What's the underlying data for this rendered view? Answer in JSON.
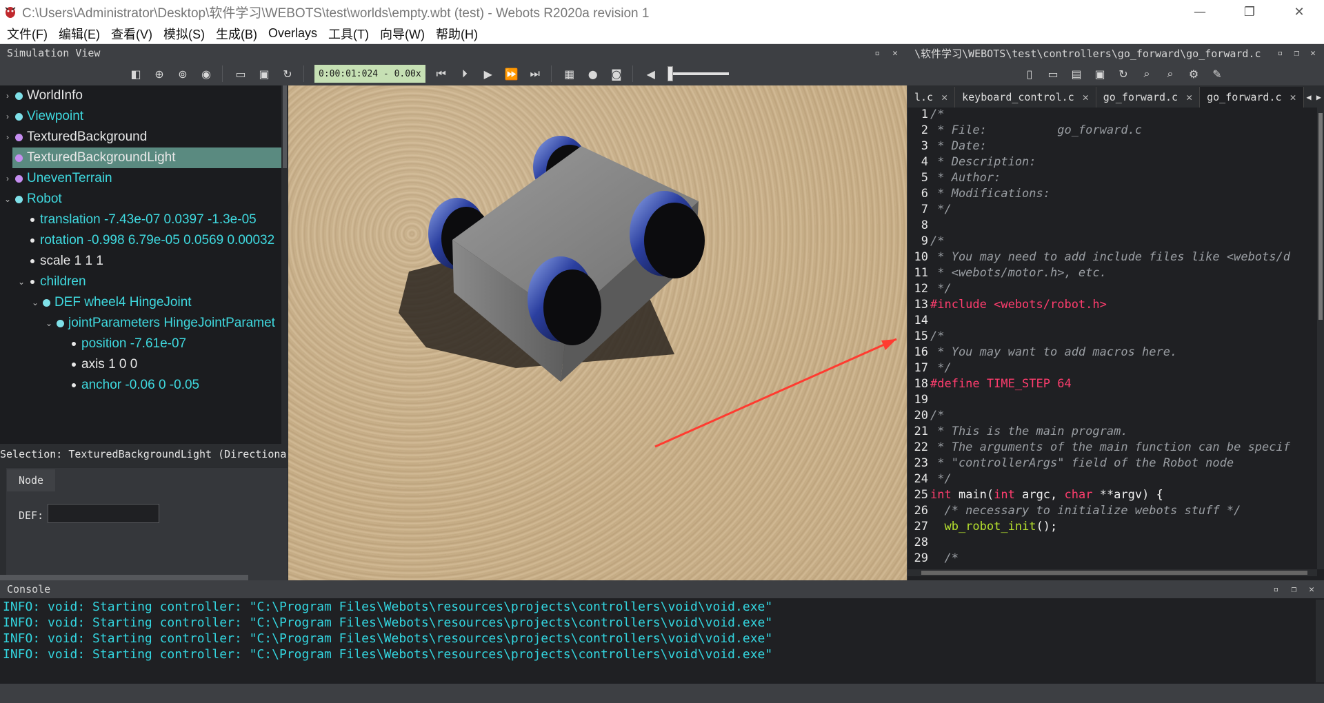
{
  "window": {
    "title": "C:\\Users\\Administrator\\Desktop\\软件学习\\WEBOTS\\test\\worlds\\empty.wbt (test) - Webots R2020a revision 1",
    "minimize": "—",
    "restore": "❐",
    "close": "✕"
  },
  "menu": [
    "文件(F)",
    "编辑(E)",
    "查看(V)",
    "模拟(S)",
    "生成(B)",
    "Overlays",
    "工具(T)",
    "向导(W)",
    "帮助(H)"
  ],
  "sim_panel": {
    "title": "Simulation View",
    "time": "0:00:01:024 - 0.00x"
  },
  "scene_tree": [
    {
      "label": "WorldInfo",
      "color": "#e8e8e8",
      "dot": "#7fe0e8",
      "indent": 0,
      "arrow": "›"
    },
    {
      "label": "Viewpoint",
      "color": "#3fd9df",
      "dot": "#7fe0e8",
      "indent": 0,
      "arrow": "›"
    },
    {
      "label": "TexturedBackground",
      "color": "#e8e8e8",
      "dot": "#c58ef0",
      "indent": 0,
      "arrow": "›"
    },
    {
      "label": "TexturedBackgroundLight",
      "color": "#e8e8e8",
      "dot": "#c58ef0",
      "indent": 0,
      "arrow": "›",
      "selected": true
    },
    {
      "label": "UnevenTerrain",
      "color": "#3fd9df",
      "dot": "#c58ef0",
      "indent": 0,
      "arrow": "›"
    },
    {
      "label": "Robot",
      "color": "#3fd9df",
      "dot": "#7fe0e8",
      "indent": 0,
      "arrow": "⌄"
    },
    {
      "label": "translation -7.43e-07 0.0397 -1.3e-05",
      "color": "#3fd9df",
      "indent": 1,
      "small": true
    },
    {
      "label": "rotation -0.998 6.79e-05 0.0569 0.00032",
      "color": "#3fd9df",
      "indent": 1,
      "small": true
    },
    {
      "label": "scale 1 1 1",
      "color": "#e8e8e8",
      "indent": 1,
      "small": true
    },
    {
      "label": "children",
      "color": "#3fd9df",
      "indent": 1,
      "small": true,
      "arrow": "⌄"
    },
    {
      "label": "DEF wheel4 HingeJoint",
      "color": "#3fd9df",
      "dot": "#7fe0e8",
      "indent": 2,
      "arrow": "⌄"
    },
    {
      "label": "jointParameters HingeJointParamet",
      "color": "#3fd9df",
      "dot": "#7fe0e8",
      "indent": 3,
      "arrow": "⌄"
    },
    {
      "label": "position -7.61e-07",
      "color": "#3fd9df",
      "indent": 4,
      "small": true
    },
    {
      "label": "axis 1 0 0",
      "color": "#e8e8e8",
      "indent": 4,
      "small": true
    },
    {
      "label": "anchor -0.06 0 -0.05",
      "color": "#3fd9df",
      "indent": 4,
      "small": true
    }
  ],
  "selection": "Selection: TexturedBackgroundLight (Directiona",
  "node_editor": {
    "tab": "Node",
    "def_label": "DEF:",
    "def_value": ""
  },
  "editor": {
    "title": "\\软件学习\\WEBOTS\\test\\controllers\\go_forward\\go_forward.c",
    "tabs": [
      {
        "label": "l.c",
        "active": false
      },
      {
        "label": "keyboard_control.c",
        "active": false
      },
      {
        "label": "go_forward.c",
        "active": false
      },
      {
        "label": "go_forward.c",
        "active": true
      }
    ],
    "lines": [
      {
        "n": "1",
        "parts": [
          {
            "t": "/*",
            "c": "c-comment"
          }
        ]
      },
      {
        "n": "2",
        "parts": [
          {
            "t": " * File:          go_forward.c",
            "c": "c-comment"
          }
        ]
      },
      {
        "n": "3",
        "parts": [
          {
            "t": " * Date:",
            "c": "c-comment"
          }
        ]
      },
      {
        "n": "4",
        "parts": [
          {
            "t": " * Description:",
            "c": "c-comment"
          }
        ]
      },
      {
        "n": "5",
        "parts": [
          {
            "t": " * Author:",
            "c": "c-comment"
          }
        ]
      },
      {
        "n": "6",
        "parts": [
          {
            "t": " * Modifications:",
            "c": "c-comment"
          }
        ]
      },
      {
        "n": "7",
        "parts": [
          {
            "t": " */",
            "c": "c-comment"
          }
        ]
      },
      {
        "n": "8",
        "parts": []
      },
      {
        "n": "9",
        "parts": [
          {
            "t": "/*",
            "c": "c-comment"
          }
        ]
      },
      {
        "n": "10",
        "parts": [
          {
            "t": " * You may need to add include files like <webots/d",
            "c": "c-comment"
          }
        ]
      },
      {
        "n": "11",
        "parts": [
          {
            "t": " * <webots/motor.h>, etc.",
            "c": "c-comment"
          }
        ]
      },
      {
        "n": "12",
        "parts": [
          {
            "t": " */",
            "c": "c-comment"
          }
        ]
      },
      {
        "n": "13",
        "parts": [
          {
            "t": "#include <webots/robot.h>",
            "c": "c-pre"
          }
        ]
      },
      {
        "n": "14",
        "parts": []
      },
      {
        "n": "15",
        "parts": [
          {
            "t": "/*",
            "c": "c-comment"
          }
        ]
      },
      {
        "n": "16",
        "parts": [
          {
            "t": " * You may want to add macros here.",
            "c": "c-comment"
          }
        ]
      },
      {
        "n": "17",
        "parts": [
          {
            "t": " */",
            "c": "c-comment"
          }
        ]
      },
      {
        "n": "18",
        "parts": [
          {
            "t": "#define TIME_STEP 64",
            "c": "c-pre"
          }
        ]
      },
      {
        "n": "19",
        "parts": []
      },
      {
        "n": "20",
        "parts": [
          {
            "t": "/*",
            "c": "c-comment"
          }
        ]
      },
      {
        "n": "21",
        "parts": [
          {
            "t": " * This is the main program.",
            "c": "c-comment"
          }
        ]
      },
      {
        "n": "22",
        "parts": [
          {
            "t": " * The arguments of the main function can be specif",
            "c": "c-comment"
          }
        ]
      },
      {
        "n": "23",
        "parts": [
          {
            "t": " * \"controllerArgs\" field of the Robot node",
            "c": "c-comment"
          }
        ]
      },
      {
        "n": "24",
        "parts": [
          {
            "t": " */",
            "c": "c-comment"
          }
        ]
      },
      {
        "n": "25",
        "parts": [
          {
            "t": "int",
            "c": "c-type"
          },
          {
            "t": " main(",
            "c": "c-plain"
          },
          {
            "t": "int",
            "c": "c-type"
          },
          {
            "t": " argc, ",
            "c": "c-plain"
          },
          {
            "t": "char",
            "c": "c-type"
          },
          {
            "t": " **argv) {",
            "c": "c-plain"
          }
        ]
      },
      {
        "n": "26",
        "parts": [
          {
            "t": "  /* necessary to initialize webots stuff */",
            "c": "c-comment"
          }
        ]
      },
      {
        "n": "27",
        "parts": [
          {
            "t": "  ",
            "c": "c-plain"
          },
          {
            "t": "wb_robot_init",
            "c": "c-fn"
          },
          {
            "t": "();",
            "c": "c-plain"
          }
        ]
      },
      {
        "n": "28",
        "parts": []
      },
      {
        "n": "29",
        "parts": [
          {
            "t": "  /*",
            "c": "c-comment"
          }
        ]
      }
    ]
  },
  "console": {
    "title": "Console",
    "lines": [
      "INFO: void: Starting controller: \"C:\\Program Files\\Webots\\resources\\projects\\controllers\\void\\void.exe\"",
      "INFO: void: Starting controller: \"C:\\Program Files\\Webots\\resources\\projects\\controllers\\void\\void.exe\"",
      "INFO: void: Starting controller: \"C:\\Program Files\\Webots\\resources\\projects\\controllers\\void\\void.exe\"",
      "INFO: void: Starting controller: \"C:\\Program Files\\Webots\\resources\\projects\\controllers\\void\\void.exe\""
    ]
  },
  "colors": {
    "accent": "#3fd9df",
    "selected_row": "#5a8a80",
    "arrow": "#ff3b30",
    "time_bg": "#c6e0b4"
  }
}
